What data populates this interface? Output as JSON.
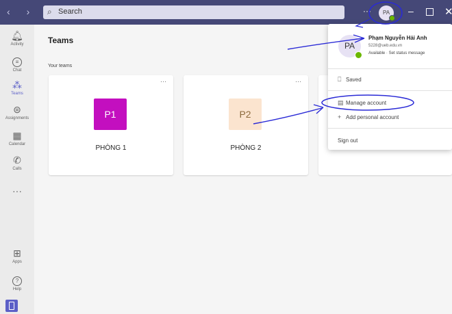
{
  "titlebar": {
    "back_icon": "‹",
    "forward_icon": "›",
    "search_placeholder": "Search",
    "more_label": "···",
    "avatar_initials": "PA",
    "minimize": "–",
    "close": "✕"
  },
  "rail": {
    "items": [
      {
        "label": "Activity",
        "icon": "bell-icon"
      },
      {
        "label": "Chat",
        "icon": "chat-icon"
      },
      {
        "label": "Teams",
        "icon": "teams-icon"
      },
      {
        "label": "Assignments",
        "icon": "assignments-icon"
      },
      {
        "label": "Calendar",
        "icon": "calendar-icon"
      },
      {
        "label": "Calls",
        "icon": "phone-icon"
      },
      {
        "label": "···",
        "icon": "more-icon"
      },
      {
        "label": "Apps",
        "icon": "apps-icon"
      },
      {
        "label": "Help",
        "icon": "help-icon"
      }
    ]
  },
  "main": {
    "title": "Teams",
    "section_label": "Your teams",
    "cards": [
      {
        "code": "P1",
        "name": "PHÒNG 1",
        "tile_color": "#c30fbf",
        "text_color": "#ffffff"
      },
      {
        "code": "P2",
        "name": "PHÒNG 2",
        "tile_color": "#fbe4cf",
        "text_color": "#8c6a3c"
      }
    ],
    "card_more": "···"
  },
  "profile_menu": {
    "initials": "PA",
    "name": "Phạm Nguyễn Hải Anh",
    "email": "5228@ueb.edu.vn",
    "status": "Available",
    "status_link": "Set status message",
    "saved": "Saved",
    "manage_account": "Manage account",
    "add_account": "Add personal account",
    "sign_out": "Sign out"
  },
  "colors": {
    "titlebar": "#454877",
    "accent": "#5b5fc7",
    "annotation": "#2a2ad6"
  }
}
